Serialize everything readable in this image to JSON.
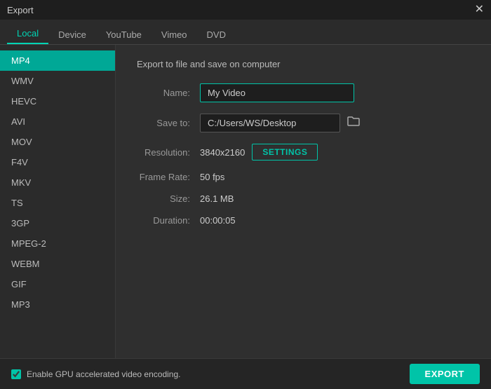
{
  "titleBar": {
    "title": "Export",
    "closeLabel": "✕"
  },
  "tabs": [
    {
      "id": "local",
      "label": "Local",
      "active": true
    },
    {
      "id": "device",
      "label": "Device",
      "active": false
    },
    {
      "id": "youtube",
      "label": "YouTube",
      "active": false
    },
    {
      "id": "vimeo",
      "label": "Vimeo",
      "active": false
    },
    {
      "id": "dvd",
      "label": "DVD",
      "active": false
    }
  ],
  "sidebar": {
    "items": [
      {
        "id": "mp4",
        "label": "MP4",
        "active": true
      },
      {
        "id": "wmv",
        "label": "WMV",
        "active": false
      },
      {
        "id": "hevc",
        "label": "HEVC",
        "active": false
      },
      {
        "id": "avi",
        "label": "AVI",
        "active": false
      },
      {
        "id": "mov",
        "label": "MOV",
        "active": false
      },
      {
        "id": "f4v",
        "label": "F4V",
        "active": false
      },
      {
        "id": "mkv",
        "label": "MKV",
        "active": false
      },
      {
        "id": "ts",
        "label": "TS",
        "active": false
      },
      {
        "id": "3gp",
        "label": "3GP",
        "active": false
      },
      {
        "id": "mpeg2",
        "label": "MPEG-2",
        "active": false
      },
      {
        "id": "webm",
        "label": "WEBM",
        "active": false
      },
      {
        "id": "gif",
        "label": "GIF",
        "active": false
      },
      {
        "id": "mp3",
        "label": "MP3",
        "active": false
      }
    ]
  },
  "content": {
    "title": "Export to file and save on computer",
    "fields": {
      "nameLabel": "Name:",
      "nameValue": "My Video",
      "saveToLabel": "Save to:",
      "saveToPath": "C:/Users/WS/Desktop",
      "resolutionLabel": "Resolution:",
      "resolutionValue": "3840x2160",
      "settingsLabel": "SETTINGS",
      "frameRateLabel": "Frame Rate:",
      "frameRateValue": "50 fps",
      "sizeLabel": "Size:",
      "sizeValue": "26.1 MB",
      "durationLabel": "Duration:",
      "durationValue": "00:00:05"
    }
  },
  "bottomBar": {
    "gpuLabel": "Enable GPU accelerated video encoding.",
    "exportLabel": "EXPORT"
  }
}
